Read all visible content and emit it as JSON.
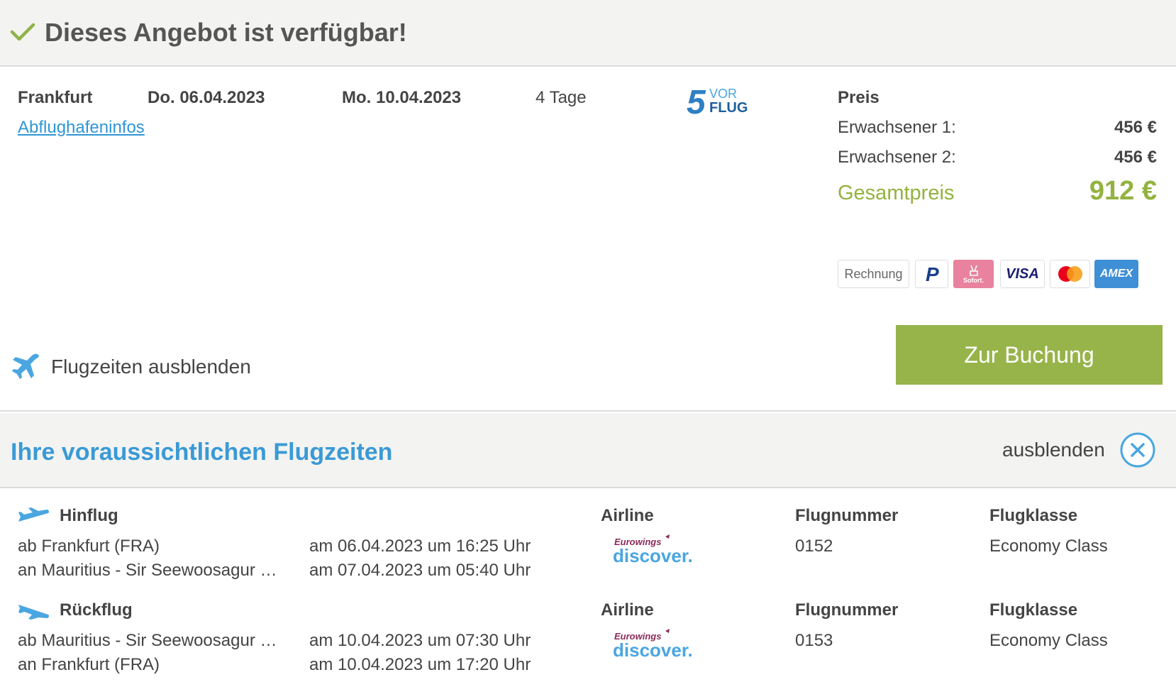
{
  "banner": {
    "title": "Dieses Angebot ist verfügbar!"
  },
  "offer": {
    "departure_city": "Frankfurt",
    "airport_info_link": "Abflughafeninfos",
    "date_out": "Do. 06.04.2023",
    "date_back": "Mo. 10.04.2023",
    "duration": "4 Tage",
    "operator_logo": {
      "number": "5",
      "top": "VOR",
      "bottom": "FLUG"
    }
  },
  "price": {
    "heading": "Preis",
    "adult1_label": "Erwachsener 1:",
    "adult1_value": "456 €",
    "adult2_label": "Erwachsener 2:",
    "adult2_value": "456 €",
    "total_label": "Gesamtpreis",
    "total_value": "912 €"
  },
  "payment": {
    "rechnung": "Rechnung",
    "paypal": "P",
    "sofort": "Sofort.",
    "visa": "VISA",
    "amex": "AMEX"
  },
  "book_button": "Zur Buchung",
  "toggle_label": "Flugzeiten ausblenden",
  "flight_times": {
    "title": "Ihre voraussichtlichen Flugzeiten",
    "hide_label": "ausblenden",
    "column_headers": {
      "airline": "Airline",
      "flight_number": "Flugnummer",
      "flight_class": "Flugklasse"
    },
    "legs": [
      {
        "label": "Hinflug",
        "from": "ab Frankfurt (FRA)",
        "to": "an Mauritius - Sir Seewoosagur …",
        "dep_time": "am 06.04.2023 um 16:25 Uhr",
        "arr_time": "am 07.04.2023 um 05:40 Uhr",
        "airline_small": "Eurowings",
        "airline_big": "discover.",
        "flight_number": "0152",
        "flight_class": "Economy Class"
      },
      {
        "label": "Rückflug",
        "from": "ab Mauritius - Sir Seewoosagur …",
        "to": "an Frankfurt (FRA)",
        "dep_time": "am 10.04.2023 um 07:30 Uhr",
        "arr_time": "am 10.04.2023 um 17:20 Uhr",
        "airline_small": "Eurowings",
        "airline_big": "discover.",
        "flight_number": "0153",
        "flight_class": "Economy Class"
      }
    ]
  },
  "colors": {
    "accent_green": "#97b44a",
    "accent_blue": "#3a9ad6",
    "panel_bg": "#f3f3f1"
  }
}
